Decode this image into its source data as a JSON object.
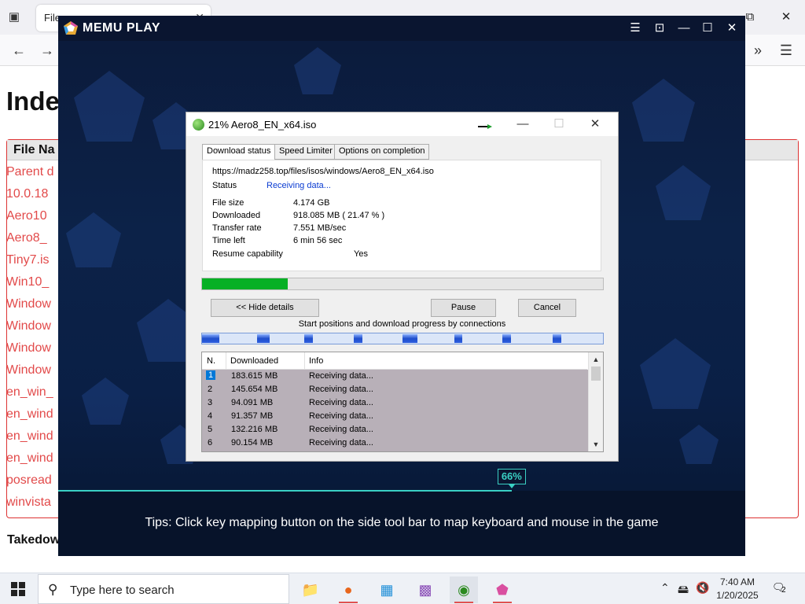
{
  "browser": {
    "tab_title": "File",
    "page_heading": "Inde",
    "file_col_header": "File Na",
    "files": [
      "Parent d",
      "10.0.18",
      "Aero10",
      "Aero8_",
      "Tiny7.is",
      "Win10_",
      "Window",
      "Window",
      "Window",
      "Window",
      "en_win_",
      "en_wind",
      "en_wind",
      "en_wind",
      "posread",
      "winvista"
    ],
    "footer": "Takedow"
  },
  "memu": {
    "title": "MEMU PLAY",
    "tips": "Tips: Click key mapping button on the side tool bar to map keyboard and mouse in the game",
    "progress_badge": "66%",
    "progress_fraction": 0.66
  },
  "dialog": {
    "title": "21% Aero8_EN_x64.iso",
    "tabs": [
      "Download status",
      "Speed Limiter",
      "Options on completion"
    ],
    "url": "https://madz258.top/files/isos/windows/Aero8_EN_x64.iso",
    "status_label": "Status",
    "status_value": "Receiving data...",
    "file_size_label": "File size",
    "file_size_value": "4.174  GB",
    "downloaded_label": "Downloaded",
    "downloaded_value": "918.085  MB  ( 21.47 % )",
    "transfer_rate_label": "Transfer rate",
    "transfer_rate_value": "7.551  MB/sec",
    "time_left_label": "Time left",
    "time_left_value": "6 min 56 sec",
    "resume_label": "Resume capability",
    "resume_value": "Yes",
    "progress_fraction": 0.2147,
    "hide_details": "<< Hide details",
    "pause": "Pause",
    "cancel": "Cancel",
    "connections_label": "Start positions and download progress by connections",
    "list_headers": [
      "N.",
      "Downloaded",
      "Info"
    ],
    "connections": [
      {
        "n": "1",
        "downloaded": "183.615  MB",
        "info": "Receiving data..."
      },
      {
        "n": "2",
        "downloaded": "145.654  MB",
        "info": "Receiving data..."
      },
      {
        "n": "3",
        "downloaded": "94.091  MB",
        "info": "Receiving data..."
      },
      {
        "n": "4",
        "downloaded": "91.357  MB",
        "info": "Receiving data..."
      },
      {
        "n": "5",
        "downloaded": "132.216  MB",
        "info": "Receiving data..."
      },
      {
        "n": "6",
        "downloaded": "90.154  MB",
        "info": "Receiving data..."
      }
    ]
  },
  "taskbar": {
    "search_placeholder": "Type here to search",
    "time": "7:40 AM",
    "date": "1/20/2025",
    "notification_count": "2"
  }
}
